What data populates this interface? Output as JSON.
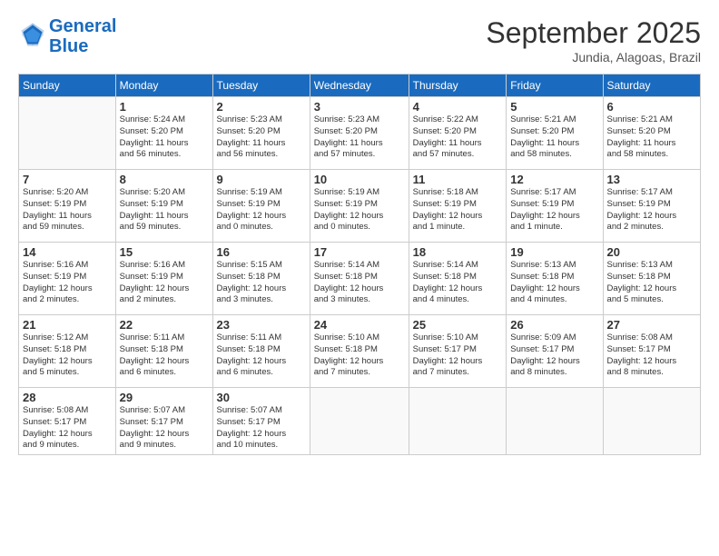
{
  "logo": {
    "line1": "General",
    "line2": "Blue"
  },
  "title": "September 2025",
  "location": "Jundia, Alagoas, Brazil",
  "days_header": [
    "Sunday",
    "Monday",
    "Tuesday",
    "Wednesday",
    "Thursday",
    "Friday",
    "Saturday"
  ],
  "weeks": [
    [
      {
        "day": "",
        "info": ""
      },
      {
        "day": "1",
        "info": "Sunrise: 5:24 AM\nSunset: 5:20 PM\nDaylight: 11 hours\nand 56 minutes."
      },
      {
        "day": "2",
        "info": "Sunrise: 5:23 AM\nSunset: 5:20 PM\nDaylight: 11 hours\nand 56 minutes."
      },
      {
        "day": "3",
        "info": "Sunrise: 5:23 AM\nSunset: 5:20 PM\nDaylight: 11 hours\nand 57 minutes."
      },
      {
        "day": "4",
        "info": "Sunrise: 5:22 AM\nSunset: 5:20 PM\nDaylight: 11 hours\nand 57 minutes."
      },
      {
        "day": "5",
        "info": "Sunrise: 5:21 AM\nSunset: 5:20 PM\nDaylight: 11 hours\nand 58 minutes."
      },
      {
        "day": "6",
        "info": "Sunrise: 5:21 AM\nSunset: 5:20 PM\nDaylight: 11 hours\nand 58 minutes."
      }
    ],
    [
      {
        "day": "7",
        "info": "Sunrise: 5:20 AM\nSunset: 5:19 PM\nDaylight: 11 hours\nand 59 minutes."
      },
      {
        "day": "8",
        "info": "Sunrise: 5:20 AM\nSunset: 5:19 PM\nDaylight: 11 hours\nand 59 minutes."
      },
      {
        "day": "9",
        "info": "Sunrise: 5:19 AM\nSunset: 5:19 PM\nDaylight: 12 hours\nand 0 minutes."
      },
      {
        "day": "10",
        "info": "Sunrise: 5:19 AM\nSunset: 5:19 PM\nDaylight: 12 hours\nand 0 minutes."
      },
      {
        "day": "11",
        "info": "Sunrise: 5:18 AM\nSunset: 5:19 PM\nDaylight: 12 hours\nand 1 minute."
      },
      {
        "day": "12",
        "info": "Sunrise: 5:17 AM\nSunset: 5:19 PM\nDaylight: 12 hours\nand 1 minute."
      },
      {
        "day": "13",
        "info": "Sunrise: 5:17 AM\nSunset: 5:19 PM\nDaylight: 12 hours\nand 2 minutes."
      }
    ],
    [
      {
        "day": "14",
        "info": "Sunrise: 5:16 AM\nSunset: 5:19 PM\nDaylight: 12 hours\nand 2 minutes."
      },
      {
        "day": "15",
        "info": "Sunrise: 5:16 AM\nSunset: 5:19 PM\nDaylight: 12 hours\nand 2 minutes."
      },
      {
        "day": "16",
        "info": "Sunrise: 5:15 AM\nSunset: 5:18 PM\nDaylight: 12 hours\nand 3 minutes."
      },
      {
        "day": "17",
        "info": "Sunrise: 5:14 AM\nSunset: 5:18 PM\nDaylight: 12 hours\nand 3 minutes."
      },
      {
        "day": "18",
        "info": "Sunrise: 5:14 AM\nSunset: 5:18 PM\nDaylight: 12 hours\nand 4 minutes."
      },
      {
        "day": "19",
        "info": "Sunrise: 5:13 AM\nSunset: 5:18 PM\nDaylight: 12 hours\nand 4 minutes."
      },
      {
        "day": "20",
        "info": "Sunrise: 5:13 AM\nSunset: 5:18 PM\nDaylight: 12 hours\nand 5 minutes."
      }
    ],
    [
      {
        "day": "21",
        "info": "Sunrise: 5:12 AM\nSunset: 5:18 PM\nDaylight: 12 hours\nand 5 minutes."
      },
      {
        "day": "22",
        "info": "Sunrise: 5:11 AM\nSunset: 5:18 PM\nDaylight: 12 hours\nand 6 minutes."
      },
      {
        "day": "23",
        "info": "Sunrise: 5:11 AM\nSunset: 5:18 PM\nDaylight: 12 hours\nand 6 minutes."
      },
      {
        "day": "24",
        "info": "Sunrise: 5:10 AM\nSunset: 5:18 PM\nDaylight: 12 hours\nand 7 minutes."
      },
      {
        "day": "25",
        "info": "Sunrise: 5:10 AM\nSunset: 5:17 PM\nDaylight: 12 hours\nand 7 minutes."
      },
      {
        "day": "26",
        "info": "Sunrise: 5:09 AM\nSunset: 5:17 PM\nDaylight: 12 hours\nand 8 minutes."
      },
      {
        "day": "27",
        "info": "Sunrise: 5:08 AM\nSunset: 5:17 PM\nDaylight: 12 hours\nand 8 minutes."
      }
    ],
    [
      {
        "day": "28",
        "info": "Sunrise: 5:08 AM\nSunset: 5:17 PM\nDaylight: 12 hours\nand 9 minutes."
      },
      {
        "day": "29",
        "info": "Sunrise: 5:07 AM\nSunset: 5:17 PM\nDaylight: 12 hours\nand 9 minutes."
      },
      {
        "day": "30",
        "info": "Sunrise: 5:07 AM\nSunset: 5:17 PM\nDaylight: 12 hours\nand 10 minutes."
      },
      {
        "day": "",
        "info": ""
      },
      {
        "day": "",
        "info": ""
      },
      {
        "day": "",
        "info": ""
      },
      {
        "day": "",
        "info": ""
      }
    ]
  ]
}
